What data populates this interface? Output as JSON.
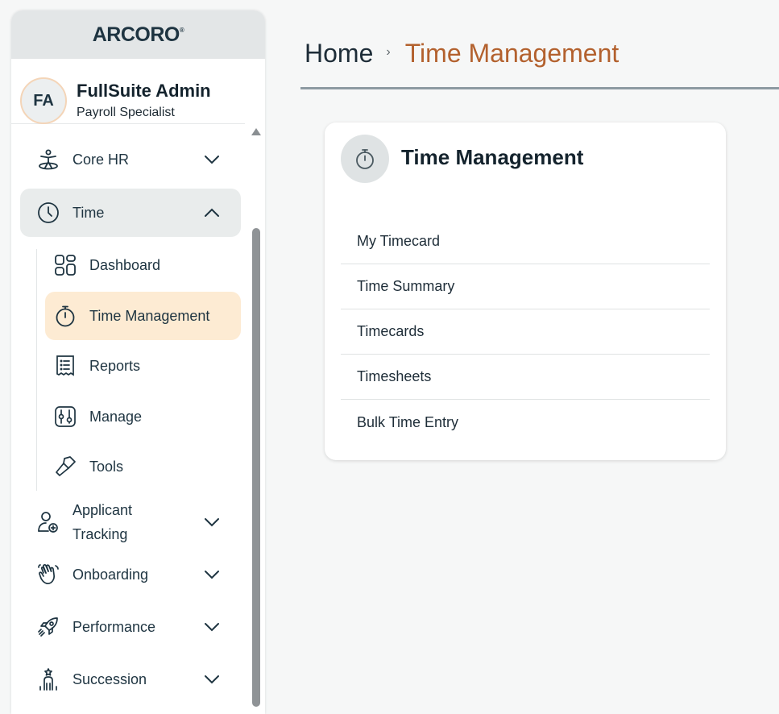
{
  "sidebar": {
    "logo": "ARCORO",
    "user": {
      "initials": "FA",
      "name": "FullSuite Admin",
      "role": "Payroll Specialist"
    },
    "nav": [
      {
        "label": "Core HR",
        "icon": "accessibility-person-icon",
        "expanded": false
      },
      {
        "label": "Time",
        "icon": "clock-icon",
        "expanded": true
      },
      {
        "label": "Applicant Tracking",
        "icon": "person-add-icon",
        "expanded": false
      },
      {
        "label": "Onboarding",
        "icon": "waving-hand-icon",
        "expanded": false
      },
      {
        "label": "Performance",
        "icon": "rocket-icon",
        "expanded": false
      },
      {
        "label": "Succession",
        "icon": "person-star-icon",
        "expanded": false
      }
    ],
    "time_sub": [
      {
        "label": "Dashboard",
        "icon": "dashboard-grid-icon"
      },
      {
        "label": "Time Management",
        "icon": "stopwatch-icon",
        "active": true
      },
      {
        "label": "Reports",
        "icon": "report-list-icon"
      },
      {
        "label": "Manage",
        "icon": "sliders-icon"
      },
      {
        "label": "Tools",
        "icon": "hammer-icon"
      }
    ],
    "applicant_line1": "Applicant",
    "applicant_line2": "Tracking"
  },
  "breadcrumb": {
    "home": "Home",
    "separator": "›",
    "current": "Time Management"
  },
  "card": {
    "title": "Time Management",
    "links": [
      "My Timecard",
      "Time Summary",
      "Timecards",
      "Timesheets",
      "Bulk Time Entry"
    ]
  },
  "colors": {
    "accent": "#b3612e",
    "active_sub_bg": "#fdebd3",
    "active_nav_bg": "#e9ecec",
    "text_dark": "#1e3441"
  }
}
